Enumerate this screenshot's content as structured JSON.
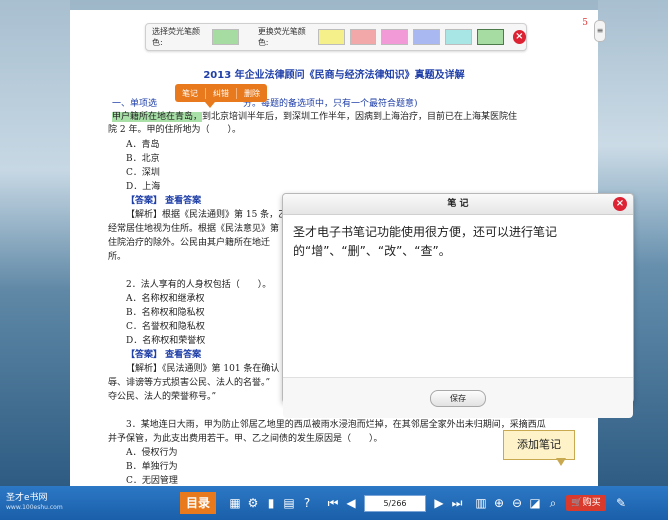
{
  "highlight_bar": {
    "select_label": "选择荧光笔颜色:",
    "change_label": "更换荧光笔颜色:",
    "selected_color": "#a6dca2",
    "swatches": [
      "#f5f08a",
      "#f2a8a8",
      "#f29ad8",
      "#aab8f2",
      "#a8e6e6",
      "#a6dca2"
    ]
  },
  "page": {
    "number": "5",
    "title": "2013 年企业法律顾问《民商与经济法律知识》真题及详解",
    "sec_prefix": "一、单项选",
    "sec_suffix": "分。每题的备选项中，只有一个最符合题意)",
    "q1_hl": "甲户籍所在地在青岛，",
    "q1_line1": "到北京培训半年后，到深圳工作半年，因病到上海治疗，目前已在上海某医院住",
    "q1_line2": "院 2 年。甲的住所地为（　　）。",
    "q1_a": "A．青岛",
    "q1_b": "B．北京",
    "q1_c": "C．深圳",
    "q1_d": "D．上海",
    "answer_label": "【答案】 查看答案",
    "q1_exp1": "【解析】根据《民法通则》第 15 条，乙",
    "q1_exp2": "经常居住地视为住所。根据《民法意见》第",
    "q1_exp3": "住院治疗的除外。公民由其户籍所在地迁",
    "q1_exp4": "所。",
    "q2": "2．法人享有的人身权包括（　　）。",
    "q2_a": "A．名称权和继承权",
    "q2_b": "B．名称权和隐私权",
    "q2_c": "C．名誉权和隐私权",
    "q2_d": "D．名称权和荣誉权",
    "q2_exp1": "【解析】《民法通则》第 101 条在确认",
    "q2_exp2": "辱、诽谤等方式损害公民、法人的名誉。”",
    "q2_exp3": "夺公民、法人的荣誉称号。”",
    "q3_line1": "3．某地连日大雨，甲为防止邻居乙地里的西瓜被雨水浸泡而烂掉，在其邻居全家外出未归期间，采摘西瓜",
    "q3_line2": "并予保管，为此支出费用若干。甲、乙之间债的发生原因是（　　）。",
    "q3_a": "A．侵权行为",
    "q3_b": "B．单独行为",
    "q3_c": "C．无因管理"
  },
  "context_menu": {
    "items": [
      "笔记",
      "纠错",
      "删除"
    ]
  },
  "note_dialog": {
    "title": "笔 记",
    "text": "圣才电子书笔记功能使用很方便，还可以进行笔记的“增”、“删”、“改”、“查”。",
    "save_label": "保存"
  },
  "tooltip": "添加笔记",
  "toolbar": {
    "brand": "圣才e书网",
    "brand_url": "www.100eshu.com",
    "toc_label": "目录",
    "page_indicator": "5/266",
    "buy_label": "购买"
  }
}
